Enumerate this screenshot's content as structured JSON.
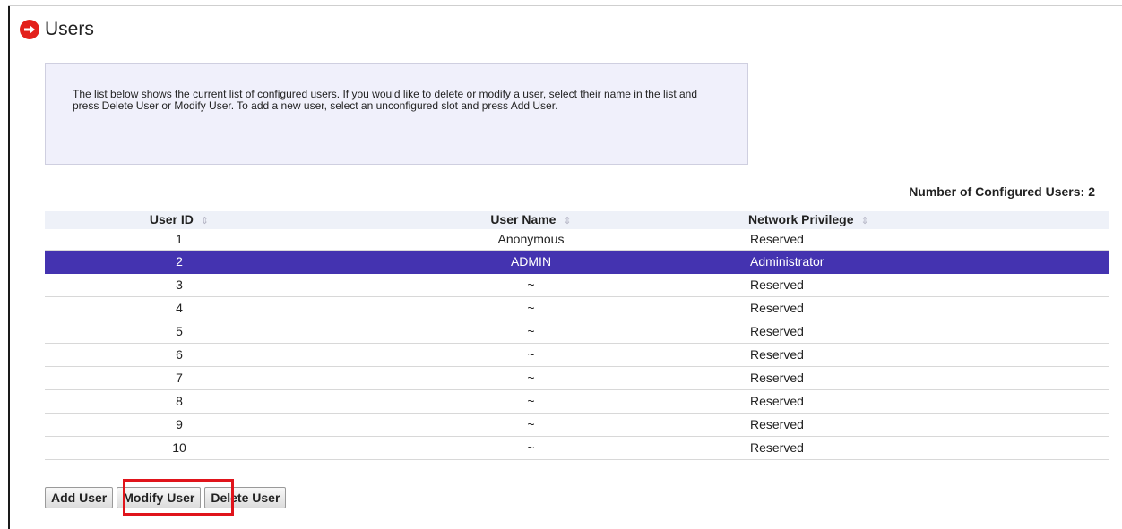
{
  "page": {
    "title": "Users",
    "info_text": "The list below shows the current list of configured users. If you would like to delete or modify a user, select their name in the list and press Delete User or Modify User. To add a new user, select an unconfigured slot and press Add User.",
    "configured_label": "Number of Configured Users:",
    "configured_count": "2"
  },
  "table": {
    "columns": [
      "User ID",
      "User Name",
      "Network Privilege"
    ],
    "sort_glyph": "↕",
    "selected_index": 1,
    "rows": [
      {
        "id": "1",
        "name": "Anonymous",
        "privilege": "Reserved"
      },
      {
        "id": "2",
        "name": "ADMIN",
        "privilege": "Administrator"
      },
      {
        "id": "3",
        "name": "~",
        "privilege": "Reserved"
      },
      {
        "id": "4",
        "name": "~",
        "privilege": "Reserved"
      },
      {
        "id": "5",
        "name": "~",
        "privilege": "Reserved"
      },
      {
        "id": "6",
        "name": "~",
        "privilege": "Reserved"
      },
      {
        "id": "7",
        "name": "~",
        "privilege": "Reserved"
      },
      {
        "id": "8",
        "name": "~",
        "privilege": "Reserved"
      },
      {
        "id": "9",
        "name": "~",
        "privilege": "Reserved"
      },
      {
        "id": "10",
        "name": "~",
        "privilege": "Reserved"
      }
    ]
  },
  "buttons": {
    "add": "Add User",
    "modify": "Modify User",
    "delete": "Delete User"
  },
  "colors": {
    "accent_red": "#e3201b",
    "selected_row": "#4433b0",
    "info_box_bg": "#f0f0fb",
    "highlight_box": "#e0141b"
  },
  "icons": {
    "title": "arrow-circle-right-icon",
    "sort": "sort-icon"
  }
}
